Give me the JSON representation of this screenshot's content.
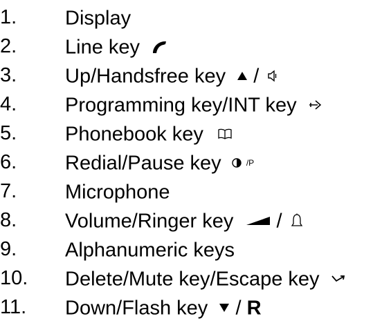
{
  "items": [
    {
      "num": "1.",
      "label": "Display"
    },
    {
      "num": "2.",
      "label": "Line key",
      "icon": "handset-icon"
    },
    {
      "num": "3.",
      "label": "Up/Handsfree key",
      "icon": "up-triangle-speaker-icon",
      "sep": "/"
    },
    {
      "num": "4.",
      "label": "Programming key/INT key",
      "icon": "intercom-arrow-icon"
    },
    {
      "num": "5.",
      "label": "Phonebook key",
      "icon": "open-book-icon"
    },
    {
      "num": "6.",
      "label": "Redial/Pause key",
      "icon": "redial-pause-icon",
      "icon_text": "/P"
    },
    {
      "num": "7.",
      "label": "Microphone"
    },
    {
      "num": "8.",
      "label": "Volume/Ringer key",
      "icon": "volume-wedge-bell-icon",
      "sep": "/"
    },
    {
      "num": "9.",
      "label": "Alphanumeric keys"
    },
    {
      "num": "10.",
      "label": "Delete/Mute key/Escape key",
      "icon": "mute-crossed-arrow-icon"
    },
    {
      "num": "11.",
      "label": "Down/Flash key",
      "icon": "down-triangle-icon",
      "sep": "/",
      "flash": "R"
    }
  ]
}
